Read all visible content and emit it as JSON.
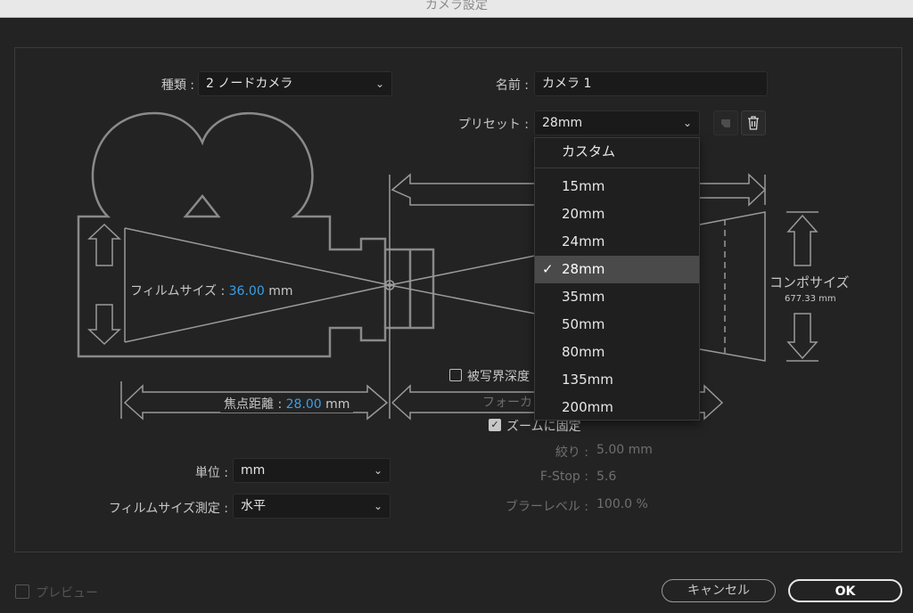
{
  "window": {
    "title": "カメラ設定"
  },
  "type": {
    "label": "種類 :",
    "value": "2 ノードカメラ"
  },
  "name": {
    "label": "名前 :",
    "value": "カメラ 1"
  },
  "preset": {
    "label": "プリセット :",
    "value": "28mm",
    "options": [
      "カスタム",
      "15mm",
      "20mm",
      "24mm",
      "28mm",
      "35mm",
      "50mm",
      "80mm",
      "135mm",
      "200mm"
    ],
    "selected": "28mm"
  },
  "film_size": {
    "label": "フィルムサイズ :",
    "value": "36.00",
    "unit": "mm"
  },
  "focal_length": {
    "label": "焦点距離 :",
    "value": "28.00",
    "unit": "mm"
  },
  "comp_size": {
    "label": "コンポサイズ",
    "value": "677.33 mm"
  },
  "depth_of_field": {
    "label": "被写界深度"
  },
  "focus": {
    "label": "フォーカ"
  },
  "zoom_lock": {
    "label": "ズームに固定"
  },
  "aperture": {
    "label": "絞り :",
    "value": "5.00 mm"
  },
  "fstop": {
    "label": "F-Stop :",
    "value": "5.6"
  },
  "blur": {
    "label": "ブラーレベル :",
    "value": "100.0 %"
  },
  "units": {
    "label": "単位 :",
    "value": "mm"
  },
  "measure": {
    "label": "フィルムサイズ測定 :",
    "value": "水平"
  },
  "preview": {
    "label": "プレビュー"
  },
  "buttons": {
    "cancel": "キャンセル",
    "ok": "OK"
  }
}
